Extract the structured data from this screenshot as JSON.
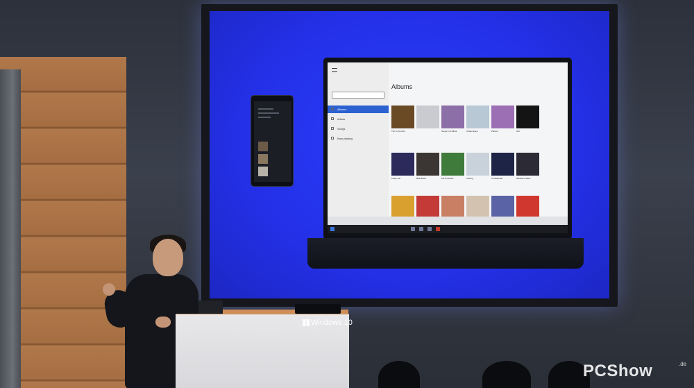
{
  "podium": {
    "brand": "Windows 10"
  },
  "app": {
    "title": "Albums",
    "nav": [
      {
        "label": "Albums"
      },
      {
        "label": "Artists"
      },
      {
        "label": "Songs"
      },
      {
        "label": "Now playing"
      }
    ],
    "albums_row1": [
      "Trip to the Arts",
      "",
      "Songs in A Minor",
      "Ocean Eyes",
      "Parlour",
      "AM"
    ],
    "albums_row2": [
      "Lady Lust",
      "Bad Blood",
      "Kid Kruschev",
      "Ctrlrlng",
      "Confidential",
      "Weekend Wars"
    ]
  },
  "watermark": {
    "text": "PCShow",
    "suffix": ".de"
  },
  "colors": {
    "screen_blue": "#2330e6",
    "wood": "#a97246",
    "accent": "#2b61d1"
  }
}
